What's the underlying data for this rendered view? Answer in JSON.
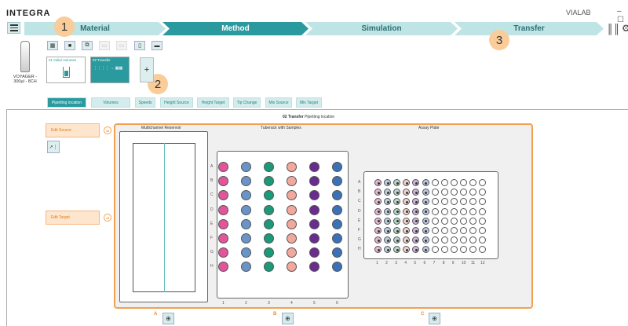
{
  "app": {
    "logo": "INTEGRA",
    "name": "VIALAB",
    "window_controls": "– ☐"
  },
  "steps": [
    {
      "label": "Material",
      "active": false
    },
    {
      "label": "Method",
      "active": true
    },
    {
      "label": "Simulation",
      "active": false
    },
    {
      "label": "Transfer",
      "active": false
    }
  ],
  "badges": [
    "1",
    "2",
    "3"
  ],
  "device": {
    "label": "VOYAGER - 300µl - 8CH"
  },
  "toolbar_icons": [
    "copy-icon",
    "add-step-icon",
    "duplicate-icon",
    "paste-icon",
    "paste-alt-icon",
    "delete-icon",
    "settings-icon"
  ],
  "program_steps": [
    {
      "title": "01 Initial Volumes"
    },
    {
      "title": "02 Transfer"
    }
  ],
  "add_step_label": "+",
  "tabs": [
    {
      "label": "Pipetting location",
      "active": true
    },
    {
      "label": "Volumes",
      "active": false
    },
    {
      "label": "Speeds",
      "active": false
    },
    {
      "label": "Height Source",
      "active": false
    },
    {
      "label": "Height Target",
      "active": false
    },
    {
      "label": "Tip Change",
      "active": false
    },
    {
      "label": "Mix Source",
      "active": false
    },
    {
      "label": "Mix Target",
      "active": false
    }
  ],
  "heading": {
    "bold": "02 Transfer",
    "rest": " Pipetting location"
  },
  "edit_source": "Edit Source",
  "edit_target": "Edit Target",
  "source_badge": "x8",
  "target_badge": "x8",
  "deck": {
    "reservoir_title": "Multichannel Reservoir",
    "tuberack_title": "Tuberack with Samples",
    "plate_title": "Assay Plate",
    "row_letters": [
      "A",
      "B",
      "C",
      "D",
      "E",
      "F",
      "G",
      "H"
    ],
    "rack_columns": [
      "1",
      "2",
      "3",
      "4",
      "5",
      "6"
    ],
    "rack_colors": [
      "#e0559c",
      "#6a94c8",
      "#1a9a78",
      "#f2a89c",
      "#6a2c8e",
      "#3a72b8"
    ],
    "plate_columns": [
      "1",
      "2",
      "3",
      "4",
      "5",
      "6",
      "7",
      "8",
      "9",
      "10",
      "11",
      "12"
    ],
    "plate_filled_colors": [
      "#e8b4d2",
      "#b8cce4",
      "#b2d8c8",
      "#f2d0c8",
      "#ccb4dc",
      "#b8c8e4"
    ]
  },
  "zoom_labels": [
    "A",
    "B",
    "C"
  ]
}
